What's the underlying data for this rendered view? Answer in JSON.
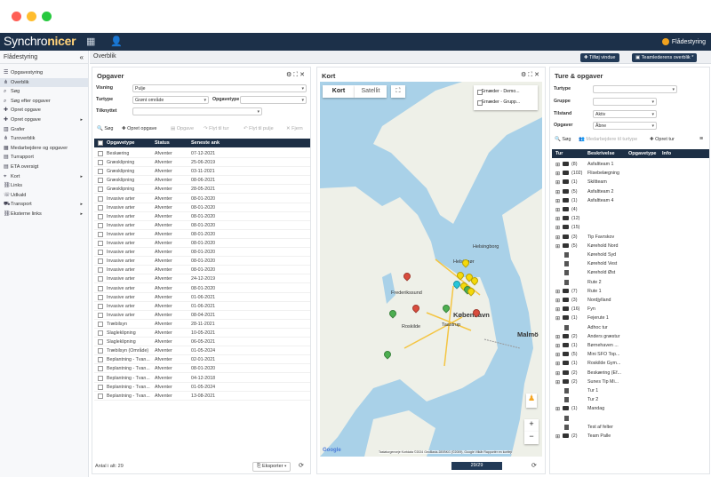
{
  "app": {
    "brand_plain": "Synchro",
    "brand_bold": "nicer",
    "module": "Flådestyring"
  },
  "sidebar": {
    "title": "Flådestyring",
    "items": [
      {
        "label": "Opgavestyring",
        "icon": "tasks-icon"
      },
      {
        "label": "Overblik",
        "icon": "sitemap-icon",
        "active": true
      },
      {
        "label": "Søg",
        "icon": "search-icon"
      },
      {
        "label": "Søg efter opgaver",
        "icon": "search-icon"
      },
      {
        "label": "Opret opgave",
        "icon": "plus-icon"
      },
      {
        "label": "Opret opgave",
        "icon": "plus-icon",
        "caret": true
      },
      {
        "label": "Grafer",
        "icon": "chart-icon"
      },
      {
        "label": "Turoverblik",
        "icon": "sitemap-icon"
      },
      {
        "label": "Medarbejdere og opgaver",
        "icon": "table-icon"
      },
      {
        "label": "Turrapport",
        "icon": "doc-icon"
      },
      {
        "label": "ETA oversigt",
        "icon": "doc-icon"
      },
      {
        "label": "Kort",
        "icon": "map-marker-icon",
        "caret": true
      },
      {
        "label": "Links",
        "icon": "link-icon"
      },
      {
        "label": "Udkald",
        "icon": "phone-icon"
      },
      {
        "label": "Transport",
        "icon": "truck-icon",
        "caret": true
      },
      {
        "label": "Eksterne links",
        "icon": "link-icon",
        "caret": true
      }
    ]
  },
  "header": {
    "title": "Overblik",
    "add_window": "Tilføj vindue",
    "overview": "Teamlederens overblik *"
  },
  "opgaver": {
    "title": "Opgaver",
    "filters": [
      {
        "label": "Visning",
        "value": "Pulje"
      },
      {
        "label": "Turtype",
        "value": "Grønt område"
      },
      {
        "label": "Opgavetype",
        "value": ""
      },
      {
        "label": "Tilknyttet",
        "value": ""
      }
    ],
    "toolbar": {
      "search": "Søg",
      "create": "Opret opgave",
      "task": "Opgave",
      "move_tur": "Flyt til tur",
      "move_pulje": "Flyt til pulje",
      "remove": "Fjern"
    },
    "columns": [
      "Opgavetype",
      "Status",
      "Seneste ank"
    ],
    "rows": [
      [
        "Beskæring",
        "Afventer",
        "07-12-2021"
      ],
      [
        "Græsklipning",
        "Afventer",
        "25-06-2019"
      ],
      [
        "Græsklipning",
        "Afventer",
        "03-11-2021"
      ],
      [
        "Græsklipning",
        "Afventer",
        "08-06-2021"
      ],
      [
        "Græsklipning",
        "Afventer",
        "28-05-2021"
      ],
      [
        "Invasive arter",
        "Afventer",
        "08-01-2020"
      ],
      [
        "Invasive arter",
        "Afventer",
        "08-01-2020"
      ],
      [
        "Invasive arter",
        "Afventer",
        "08-01-2020"
      ],
      [
        "Invasive arter",
        "Afventer",
        "08-01-2020"
      ],
      [
        "Invasive arter",
        "Afventer",
        "08-01-2020"
      ],
      [
        "Invasive arter",
        "Afventer",
        "08-01-2020"
      ],
      [
        "Invasive arter",
        "Afventer",
        "08-01-2020"
      ],
      [
        "Invasive arter",
        "Afventer",
        "08-01-2020"
      ],
      [
        "Invasive arter",
        "Afventer",
        "08-01-2020"
      ],
      [
        "Invasive arter",
        "Afventer",
        "24-12-2019"
      ],
      [
        "Invasive arter",
        "Afventer",
        "08-01-2020"
      ],
      [
        "Invasive arter",
        "Afventer",
        "01-06-2021"
      ],
      [
        "Invasive arter",
        "Afventer",
        "01-06-2021"
      ],
      [
        "Invasive arter",
        "Afventer",
        "08-04-2021"
      ],
      [
        "Træbilsyn",
        "Afventer",
        "28-11-2021"
      ],
      [
        "Slagleklipning",
        "Afventer",
        "10-05-2021"
      ],
      [
        "Slagleklipning",
        "Afventer",
        "06-05-2021"
      ],
      [
        "Træbilsyn (Område)",
        "Afventer",
        "01-05-2024"
      ],
      [
        "Beplantning - Tvan...",
        "Afventer",
        "02-01-2021"
      ],
      [
        "Beplantning - Tvan...",
        "Afventer",
        "08-01-2020"
      ],
      [
        "Beplantning - Tvan...",
        "Afventer",
        "04-12-2018"
      ],
      [
        "Beplantning - Tvan...",
        "Afventer",
        "01-05-2024"
      ],
      [
        "Beplantning - Tvan...",
        "Afventer",
        "13-08-2021"
      ]
    ],
    "footer_count": "Antal i alt: 29",
    "export": "Eksporter"
  },
  "kort": {
    "title": "Kort",
    "tab_map": "Kort",
    "tab_sat": "Satellit",
    "legend": [
      "Ernæder - Demo...",
      "Ernæder - Grupp..."
    ],
    "labels": {
      "kobenhavn": "København",
      "malmo": "Malmö",
      "helsingborg": "Helsingborg",
      "roskilde": "Roskilde",
      "frederikssund": "Frederikssund",
      "helsingor": "Helsingør",
      "taastrup": "Taastrup"
    },
    "attribution": "Tastaturgenveje   Kortdata ©2024 GeoBasis-DE/BKG (©2009), Google   Vilkår   Rapportér en kortfejl",
    "google": "Google",
    "pager": "29/29"
  },
  "ture": {
    "title": "Ture & opgaver",
    "filters": [
      {
        "label": "Turtype",
        "value": ""
      },
      {
        "label": "Gruppe",
        "value": ""
      },
      {
        "label": "Tilstand",
        "value": "Aktiv"
      },
      {
        "label": "Opgaver",
        "value": "Åbne"
      }
    ],
    "toolbar": {
      "search": "Søg",
      "employees": "Medarbejdere til turtype",
      "create": "Opret tur"
    },
    "columns": [
      "Tur",
      "Beskrivelse",
      "Opgavetype",
      "Info"
    ],
    "rows": [
      {
        "type": "folder",
        "count": "(8)",
        "desc": "Asfaltteam 1"
      },
      {
        "type": "folder",
        "count": "(102)",
        "desc": "Flisebelægning"
      },
      {
        "type": "folder",
        "count": "(1)",
        "desc": "Skiltteam"
      },
      {
        "type": "folder",
        "count": "(5)",
        "desc": "Asfaltteam 2"
      },
      {
        "type": "folder",
        "count": "(1)",
        "desc": "Asfaltteam 4"
      },
      {
        "type": "folder",
        "count": "(4)",
        "desc": ""
      },
      {
        "type": "folder",
        "count": "(12)",
        "desc": ""
      },
      {
        "type": "folder",
        "count": "(15)",
        "desc": ""
      },
      {
        "type": "folder",
        "count": "(3)",
        "desc": "Tip Favrskov"
      },
      {
        "type": "folder",
        "count": "(5)",
        "desc": "Kørehold Nord"
      },
      {
        "type": "doc",
        "count": "",
        "desc": "Kørehold Syd"
      },
      {
        "type": "doc",
        "count": "",
        "desc": "Kørehold Vest"
      },
      {
        "type": "doc",
        "count": "",
        "desc": "Kørehold Øst"
      },
      {
        "type": "doc",
        "count": "",
        "desc": "Rute 2"
      },
      {
        "type": "folder",
        "count": "(7)",
        "desc": "Rute 1"
      },
      {
        "type": "folder",
        "count": "(3)",
        "desc": "Nordjylland"
      },
      {
        "type": "folder",
        "count": "(16)",
        "desc": "Fyn"
      },
      {
        "type": "folder",
        "count": "(1)",
        "desc": "Fejerute 1"
      },
      {
        "type": "doc",
        "count": "",
        "desc": "Adhoc tur"
      },
      {
        "type": "folder",
        "count": "(2)",
        "desc": "Anders græstur"
      },
      {
        "type": "folder",
        "count": "(1)",
        "desc": "Børnehaven ..."
      },
      {
        "type": "folder",
        "count": "(5)",
        "desc": "Mini SFO Top..."
      },
      {
        "type": "folder",
        "count": "(1)",
        "desc": "Roskilde Gym..."
      },
      {
        "type": "folder",
        "count": "(2)",
        "desc": "Beskæring (Ef..."
      },
      {
        "type": "folder",
        "count": "(2)",
        "desc": "Sunes Tip Mi..."
      },
      {
        "type": "doc",
        "count": "",
        "desc": "Tur 1"
      },
      {
        "type": "doc",
        "count": "",
        "desc": "Tur 2"
      },
      {
        "type": "folder",
        "count": "(1)",
        "desc": "Mandag"
      },
      {
        "type": "doc",
        "count": "",
        "desc": ""
      },
      {
        "type": "doc",
        "count": "",
        "desc": "Test af felter"
      },
      {
        "type": "folder",
        "count": "(2)",
        "desc": "Team Palle"
      }
    ]
  },
  "colors": {
    "nav": "#1c3049",
    "accent": "#f0a11e",
    "header_dark": "#1d2f45"
  }
}
